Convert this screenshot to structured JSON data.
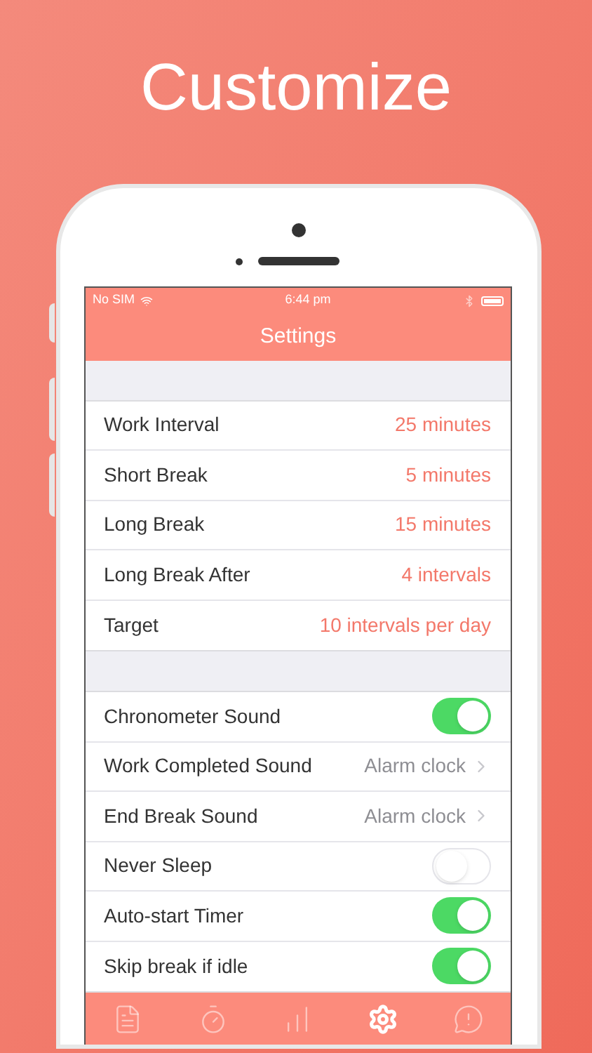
{
  "headline": "Customize",
  "status_bar": {
    "carrier": "No SIM",
    "time": "6:44 pm"
  },
  "nav": {
    "title": "Settings"
  },
  "sections": [
    {
      "rows": [
        {
          "kind": "value",
          "label": "Work Interval",
          "value": "25 minutes"
        },
        {
          "kind": "value",
          "label": "Short Break",
          "value": "5 minutes"
        },
        {
          "kind": "value",
          "label": "Long Break",
          "value": "15 minutes"
        },
        {
          "kind": "value",
          "label": "Long Break After",
          "value": "4 intervals"
        },
        {
          "kind": "value",
          "label": "Target",
          "value": "10 intervals per day"
        }
      ]
    },
    {
      "rows": [
        {
          "kind": "toggle",
          "label": "Chronometer Sound",
          "on": true
        },
        {
          "kind": "link",
          "label": "Work Completed Sound",
          "value": "Alarm clock"
        },
        {
          "kind": "link",
          "label": "End Break Sound",
          "value": "Alarm clock"
        },
        {
          "kind": "toggle",
          "label": "Never Sleep",
          "on": false
        },
        {
          "kind": "toggle",
          "label": "Auto-start Timer",
          "on": true
        },
        {
          "kind": "toggle",
          "label": "Skip break if idle",
          "on": true
        }
      ]
    }
  ],
  "tabs": [
    {
      "kind": "list",
      "selected": false
    },
    {
      "kind": "timer",
      "selected": false
    },
    {
      "kind": "stats",
      "selected": false
    },
    {
      "kind": "settings",
      "selected": true
    },
    {
      "kind": "info",
      "selected": false
    }
  ]
}
